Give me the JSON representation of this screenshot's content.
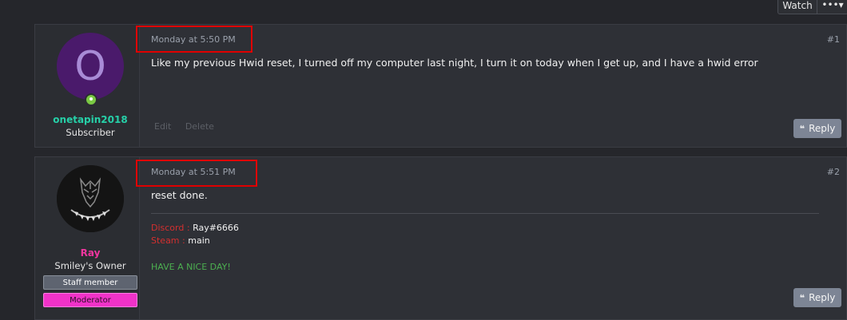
{
  "thread_controls": {
    "watch_label": "Watch",
    "more_label": "•••▾"
  },
  "posts": [
    {
      "avatar_letter": "O",
      "username": "onetapin2018",
      "username_color": "#26d0a8",
      "user_title": "Subscriber",
      "date": "Monday at 5:50 PM",
      "number": "#1",
      "content": "Like my previous Hwid reset, I turned off my computer last night, I turn it on today when I get up, and I have a hwid error",
      "actions": {
        "edit": "Edit",
        "delete": "Delete"
      },
      "reply_label": "Reply"
    },
    {
      "username": "Ray",
      "username_color": "#f0369f",
      "user_title": "Smiley's Owner",
      "badges": [
        "Staff member",
        "Moderator"
      ],
      "date": "Monday at 5:51 PM",
      "number": "#2",
      "content": "reset done.",
      "signature": {
        "discord_label": "Discord :",
        "discord_value": "Ray#6666",
        "steam_label": "Steam :",
        "steam_value": "main",
        "closing": "HAVE A NICE DAY!"
      },
      "reply_label": "Reply"
    }
  ],
  "colors": {
    "highlight": "#e00000",
    "signature_label": "#d32f2f",
    "signature_closing": "#4caf50",
    "moderator_badge": "#f032c8"
  }
}
